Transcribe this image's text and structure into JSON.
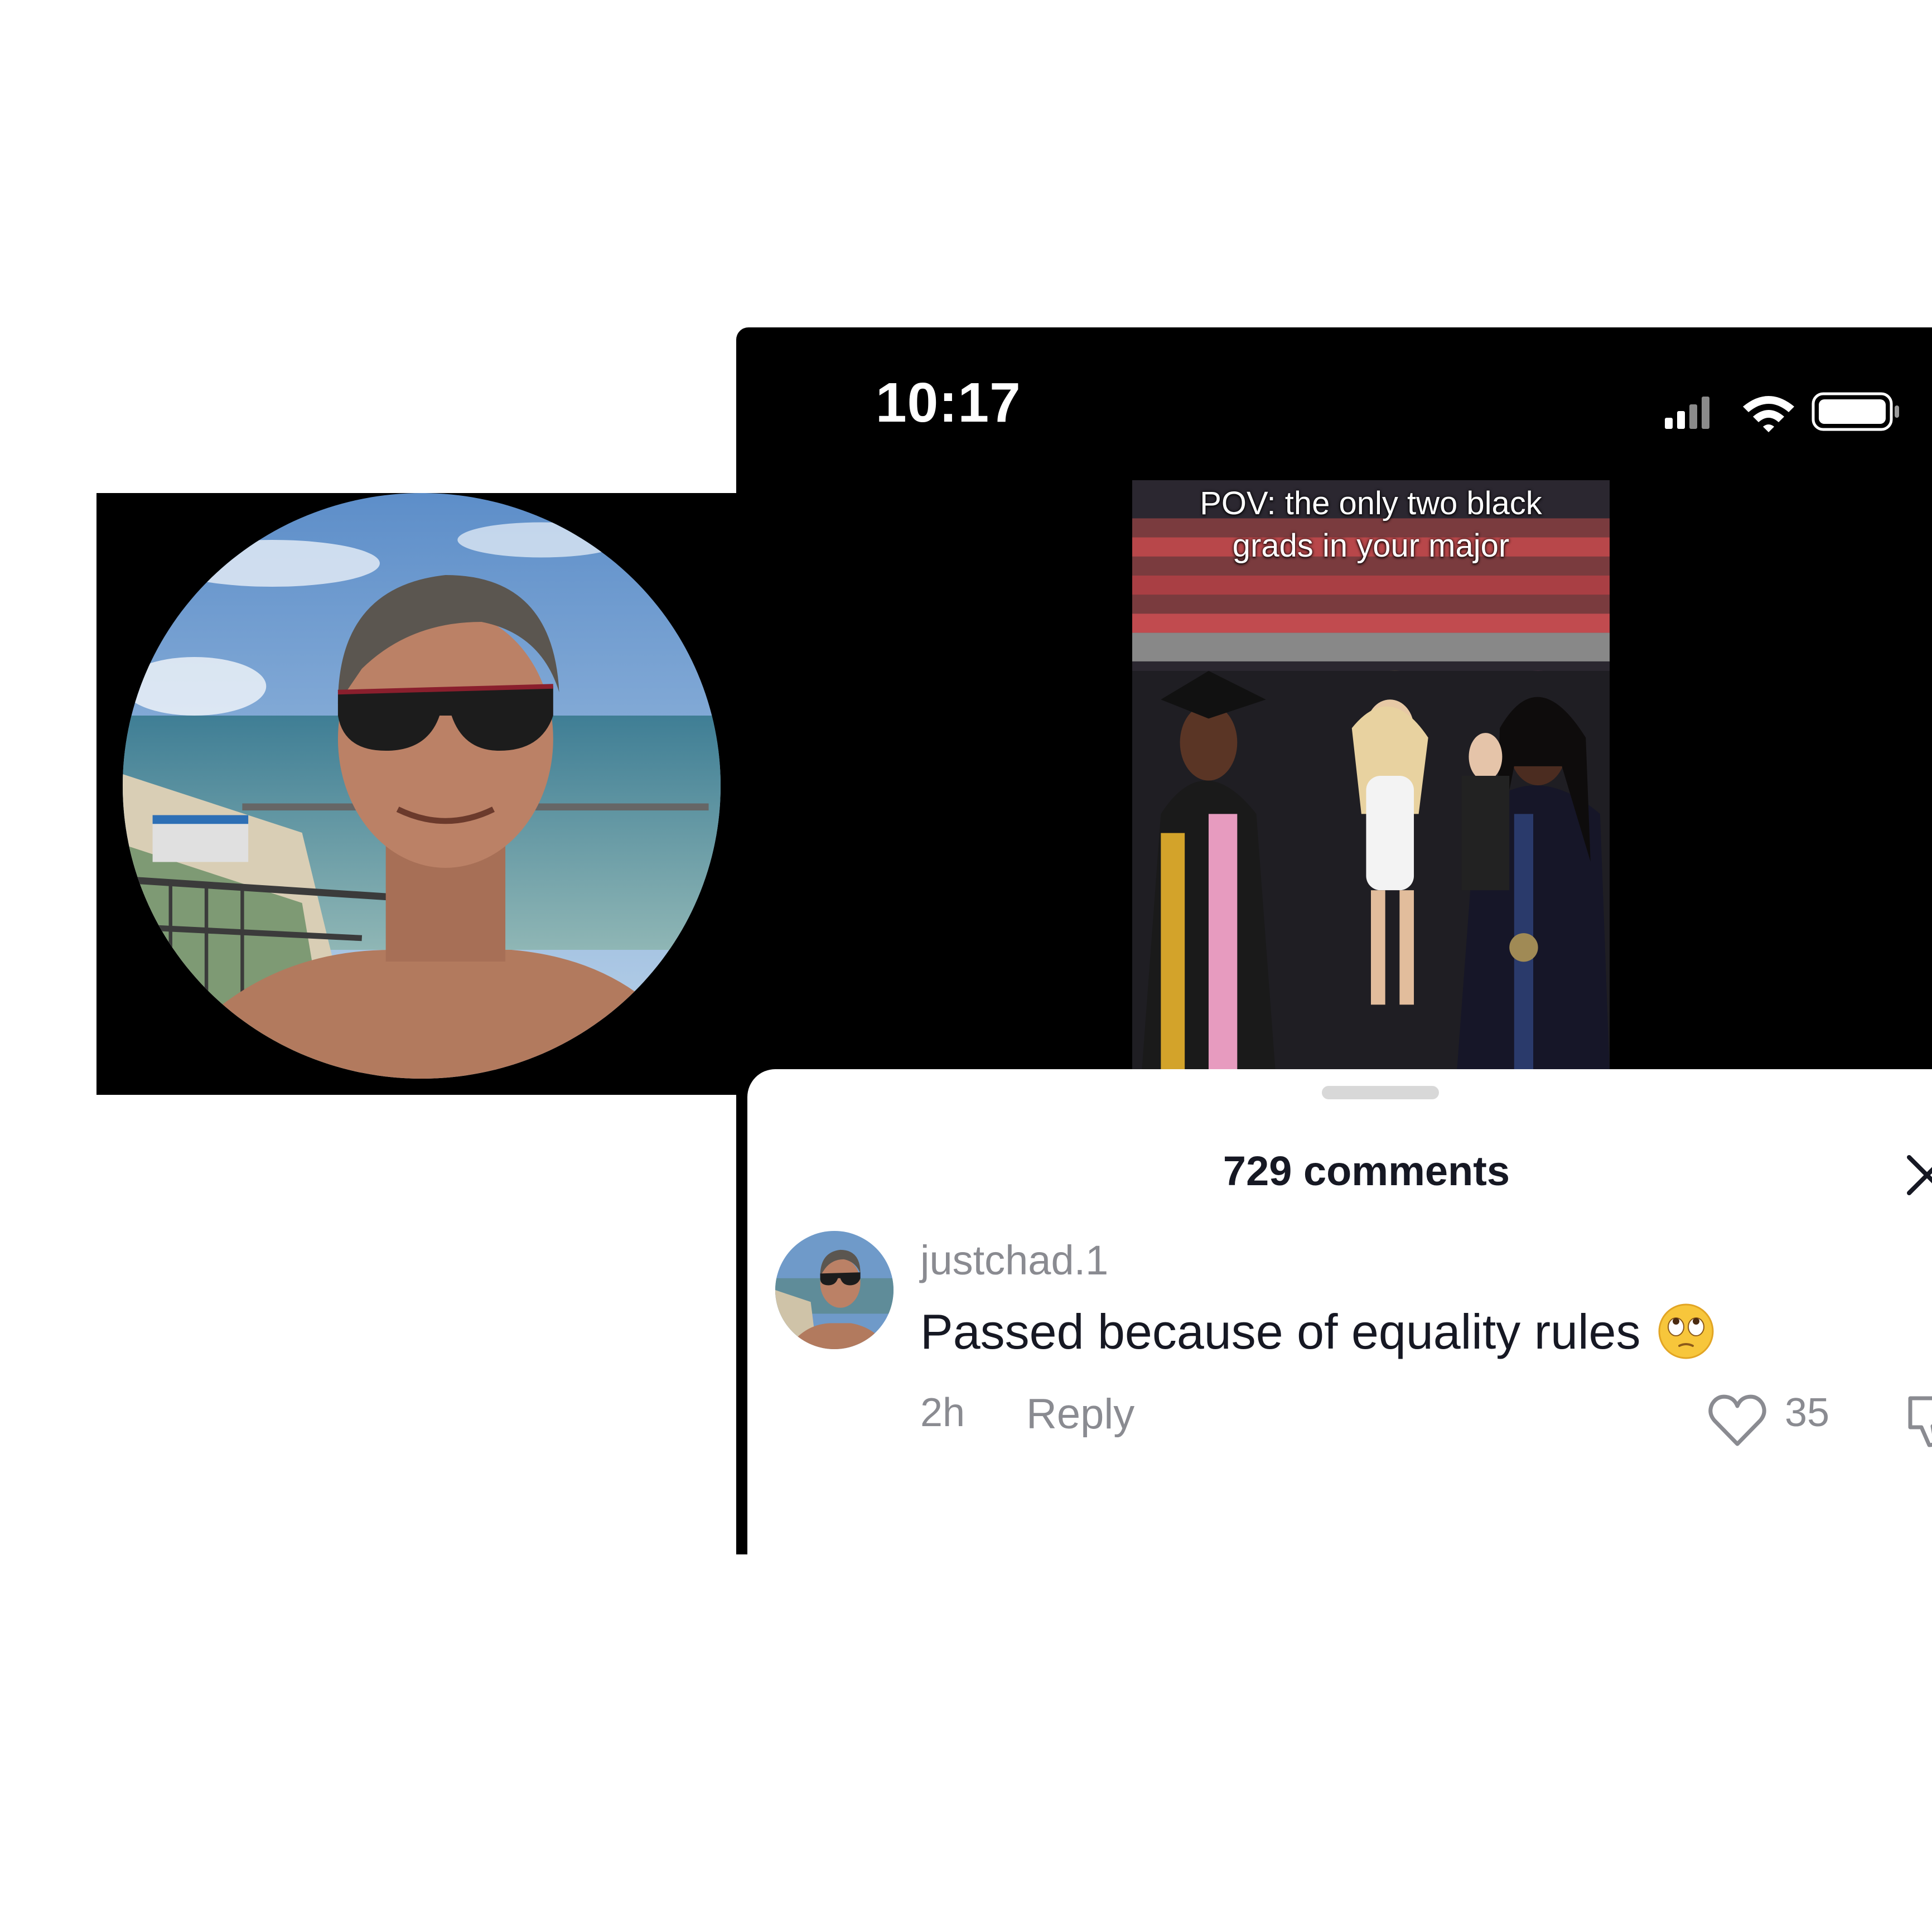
{
  "status_bar": {
    "time": "10:17",
    "signal_icon": "cellular-signal-icon",
    "wifi_icon": "wifi-icon",
    "battery_icon": "battery-icon"
  },
  "video": {
    "caption_line1": "POV: the only two black",
    "caption_line2": "grads in your major"
  },
  "comments_sheet": {
    "count_label": "729 comments",
    "close_icon": "close-icon"
  },
  "comment": {
    "username": "justchad.1",
    "text": "Passed because of equality rules",
    "emoji": "face-with-rolling-eyes",
    "time": "2h",
    "reply_label": "Reply",
    "like_count": "35",
    "like_icon": "heart-icon",
    "dislike_icon": "thumbs-down-icon"
  },
  "colors": {
    "text_primary": "#161823",
    "text_secondary": "#8a8b91",
    "background": "#ffffff",
    "phone_background": "#000000"
  }
}
